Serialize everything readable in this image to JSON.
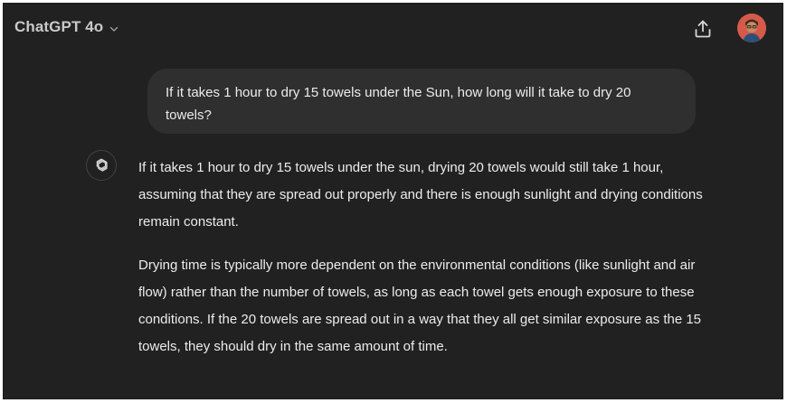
{
  "header": {
    "model_name": "ChatGPT 4o",
    "icons": {
      "model_dropdown": "chevron-down-icon",
      "share": "share-icon",
      "avatar": "user-avatar"
    }
  },
  "conversation": {
    "user_message": "If it takes 1 hour to dry 15 towels under the Sun, how long will it take to dry 20 towels?",
    "assistant_message": {
      "icon": "openai-logo-icon",
      "paragraphs": [
        "If it takes 1 hour to dry 15 towels under the sun, drying 20 towels would still take 1 hour, assuming that they are spread out properly and there is enough sunlight and drying conditions remain constant.",
        "Drying time is typically more dependent on the environmental conditions (like sunlight and air flow) rather than the number of towels, as long as each towel gets enough exposure to these conditions. If the 20 towels are spread out in a way that they all get similar exposure as the 15 towels, they should dry in the same amount of time."
      ]
    }
  },
  "colors": {
    "background": "#212121",
    "user_bubble": "#2f2f2f",
    "text": "#ececec"
  }
}
